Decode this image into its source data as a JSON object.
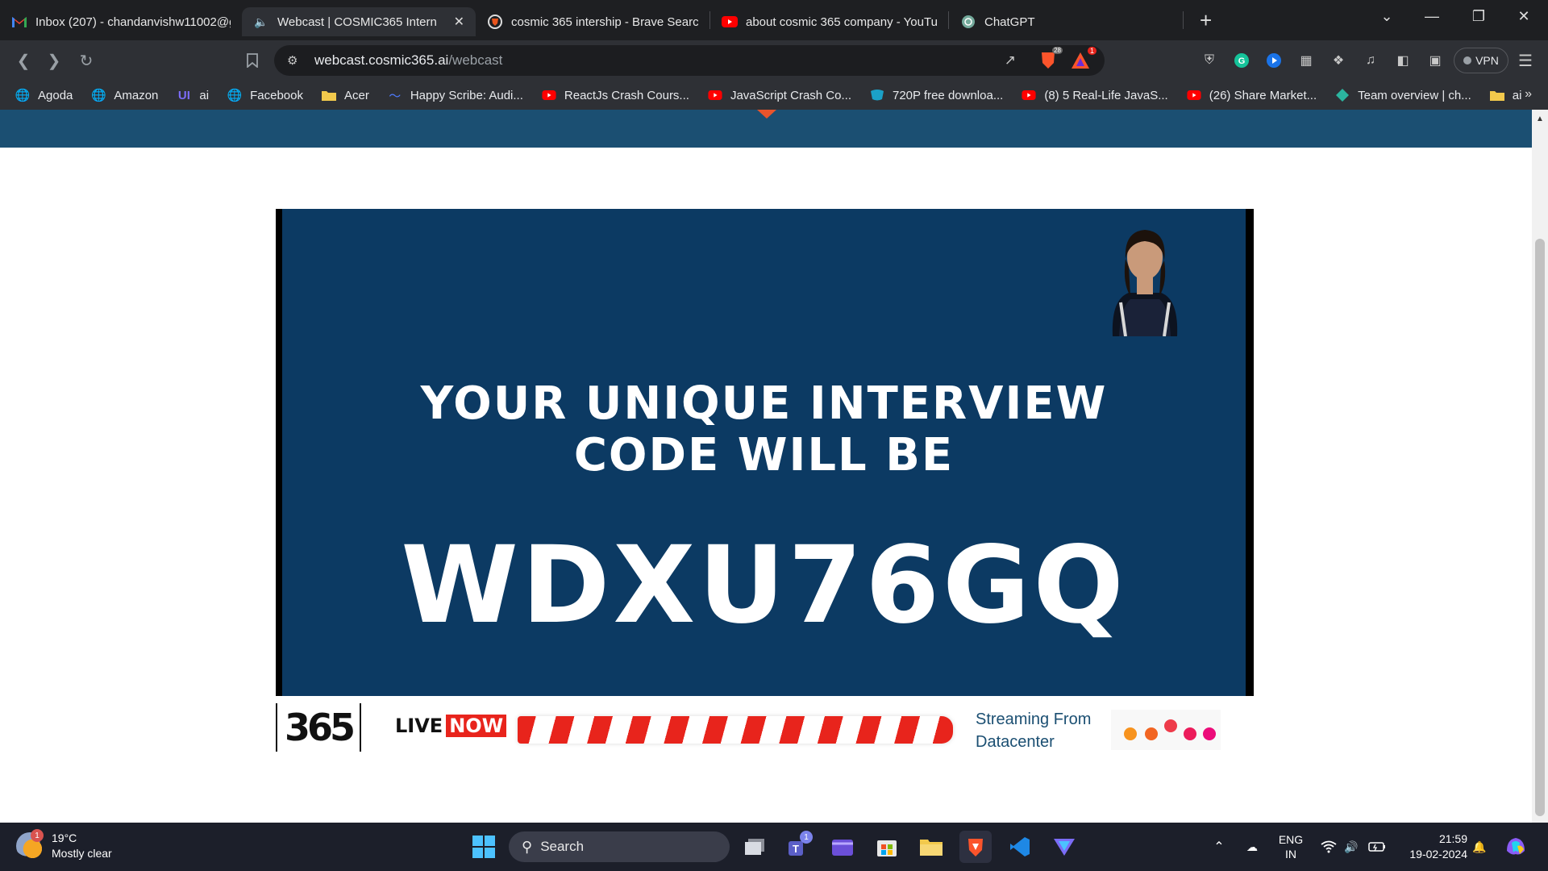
{
  "tabs": [
    {
      "title": "Inbox (207) - chandanvishw11002@g",
      "icon": "gmail-icon",
      "active": false
    },
    {
      "title": "Webcast | COSMIC365 Intern",
      "icon": "speaker-icon",
      "active": true
    },
    {
      "title": "cosmic 365 intership - Brave Search",
      "icon": "brave-search-icon",
      "active": false
    },
    {
      "title": "about cosmic 365 company - YouTub",
      "icon": "youtube-icon",
      "active": false
    },
    {
      "title": "ChatGPT",
      "icon": "chatgpt-icon",
      "active": false
    }
  ],
  "omnibox": {
    "host": "webcast.cosmic365.ai",
    "path": "/webcast"
  },
  "extensions": {
    "shields_count": "28",
    "rewards_count": "1",
    "vpn_label": "VPN"
  },
  "bookmarks": [
    {
      "label": "Agoda",
      "icon": "globe-icon"
    },
    {
      "label": "Amazon",
      "icon": "globe-icon"
    },
    {
      "label": "ai",
      "icon": "ui-icon"
    },
    {
      "label": "Facebook",
      "icon": "globe-icon"
    },
    {
      "label": "Acer",
      "icon": "folder-icon"
    },
    {
      "label": "Happy Scribe: Audi...",
      "icon": "happyscribe-icon"
    },
    {
      "label": "ReactJs Crash Cours...",
      "icon": "youtube-icon"
    },
    {
      "label": "JavaScript Crash Co...",
      "icon": "youtube-icon"
    },
    {
      "label": "720P free downloa...",
      "icon": "download-icon"
    },
    {
      "label": "(8) 5 Real-Life JavaS...",
      "icon": "youtube-icon"
    },
    {
      "label": "(26) Share Market...",
      "icon": "youtube-icon"
    },
    {
      "label": "Team overview | ch...",
      "icon": "diamond-icon"
    },
    {
      "label": "ai",
      "icon": "folder-icon"
    }
  ],
  "webcast": {
    "headline_line1": "YOUR UNIQUE INTERVIEW",
    "headline_line2": "CODE WILL BE",
    "code": "WDXU76GQ",
    "logo_text": "365",
    "live_label": "LIVE",
    "now_label": "NOW",
    "streaming_line1": "Streaming From",
    "streaming_line2": "Datacenter"
  },
  "colors": {
    "band": "#1b4f72",
    "video_bg": "#0c3a63",
    "live_red": "#e8241c",
    "accent_orange": "#e8542c"
  },
  "taskbar": {
    "weather_temp": "19°C",
    "weather_desc": "Mostly clear",
    "weather_badge": "1",
    "search_label": "Search",
    "teams_badge": "1",
    "lang_line1": "ENG",
    "lang_line2": "IN",
    "time": "21:59",
    "date": "19-02-2024"
  }
}
